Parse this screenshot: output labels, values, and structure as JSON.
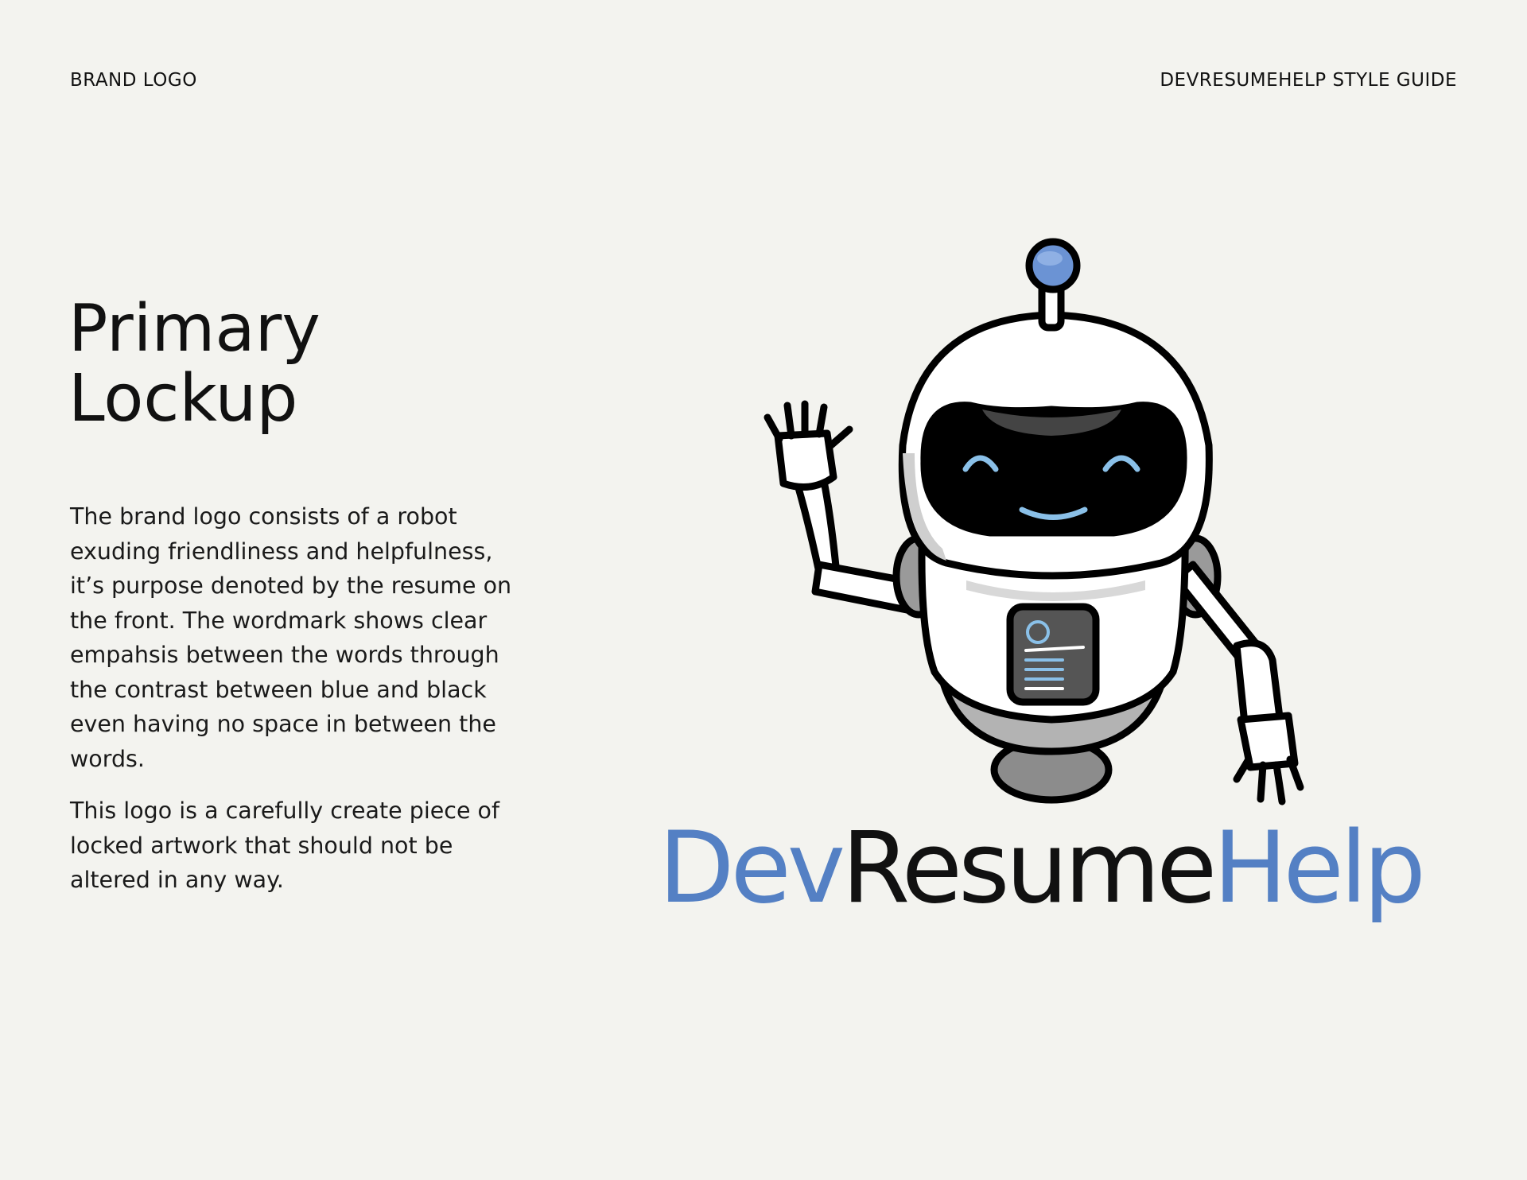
{
  "header": {
    "section": "BRAND LOGO",
    "guide": "DEVRESUMEHELP STYLE GUIDE"
  },
  "title": {
    "line1": "Primary",
    "line2": "Lockup"
  },
  "body": {
    "paragraph1": "The brand logo consists of a robot exuding friendliness and helpfulness, it’s purpose denoted by the resume on the front. The wordmark shows clear empahsis between the words through the contrast between blue and black even having no space in between the words.",
    "paragraph2": "This logo is a carefully create piece of locked artwork that should not be altered in any way."
  },
  "logo": {
    "icon": "robot-mascot",
    "wordmark": {
      "part1": "Dev",
      "part2": "Resume",
      "part3": "Help"
    }
  },
  "colors": {
    "background": "#f3f3ef",
    "brand_blue": "#5480c4",
    "text_black": "#111111",
    "accent_light_blue": "#8ac0e8"
  }
}
